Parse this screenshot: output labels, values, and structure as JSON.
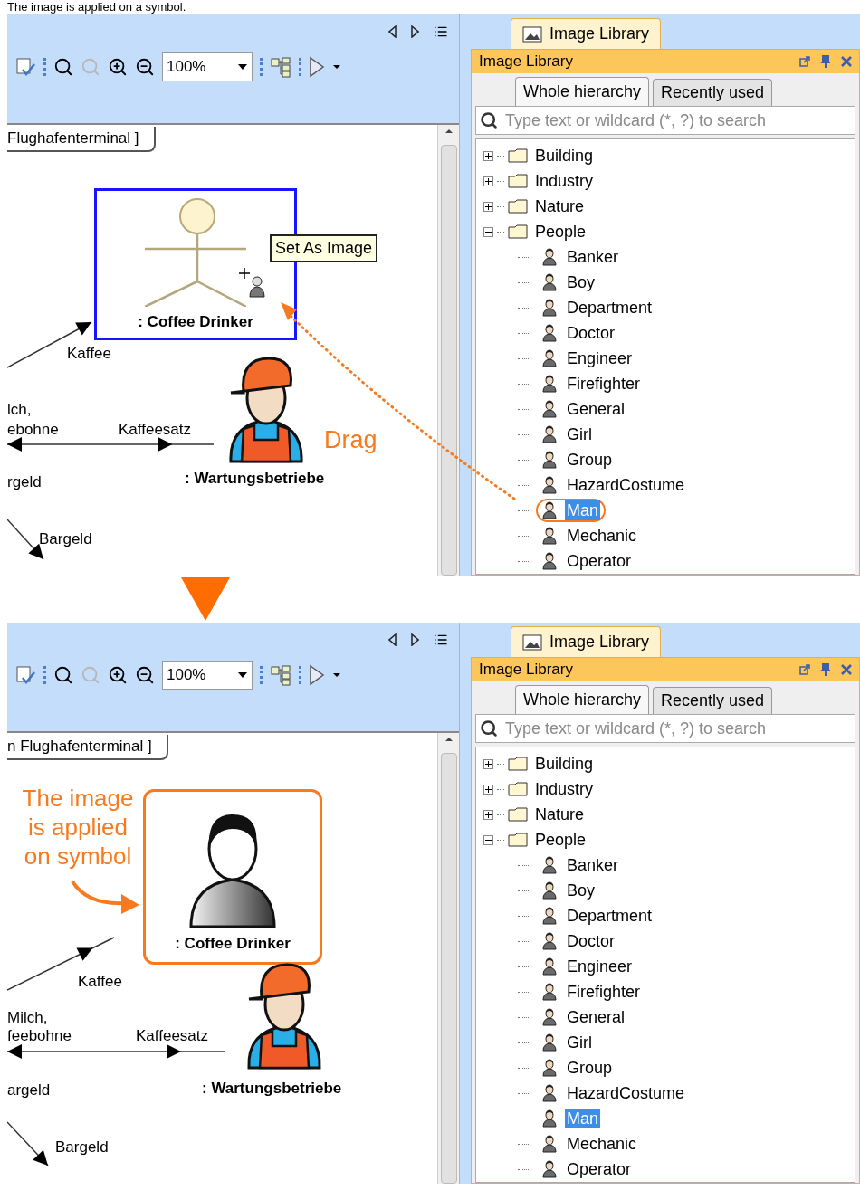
{
  "caption": "The image is applied on a symbol.",
  "steps": [
    {
      "kind": "drag",
      "editor": {
        "zoom": "100%",
        "frame_title": "Flughafenterminal ]",
        "actor": {
          "label": ": Coffee Drinker",
          "kind": "stick",
          "selected": true,
          "highlighted": false
        },
        "tooltip": "Set As Image",
        "annotation": "Drag",
        "worker_label": ": Wartungsbetriebe",
        "labels": [
          "Kaffee",
          "lch,",
          "ebohne",
          "Kaffeesatz",
          "rgeld",
          "Bargeld"
        ]
      },
      "library": {
        "tab": "Image Library",
        "title": "Image Library",
        "tabs": [
          {
            "label": "Whole hierarchy",
            "selected": true
          },
          {
            "label": "Recently used",
            "selected": false
          }
        ],
        "search": {
          "placeholder": "Type text or wildcard (*, ?) to search"
        },
        "tree": [
          {
            "label": "Building",
            "expanded": false
          },
          {
            "label": "Industry",
            "expanded": false
          },
          {
            "label": "Nature",
            "expanded": false
          },
          {
            "label": "People",
            "expanded": true,
            "children": [
              {
                "label": "Banker",
                "selected": false,
                "circled": false
              },
              {
                "label": "Boy",
                "selected": false,
                "circled": false
              },
              {
                "label": "Department",
                "selected": false,
                "circled": false
              },
              {
                "label": "Doctor",
                "selected": false,
                "circled": false
              },
              {
                "label": "Engineer",
                "selected": false,
                "circled": false
              },
              {
                "label": "Firefighter",
                "selected": false,
                "circled": false
              },
              {
                "label": "General",
                "selected": false,
                "circled": false
              },
              {
                "label": "Girl",
                "selected": false,
                "circled": false
              },
              {
                "label": "Group",
                "selected": false,
                "circled": false
              },
              {
                "label": "HazardCostume",
                "selected": false,
                "circled": false
              },
              {
                "label": "Man",
                "selected": true,
                "circled": true
              },
              {
                "label": "Mechanic",
                "selected": false,
                "circled": false
              },
              {
                "label": "Operator",
                "selected": false,
                "circled": false
              }
            ]
          }
        ]
      }
    },
    {
      "kind": "applied",
      "editor": {
        "zoom": "100%",
        "frame_title": "n Flughafenterminal ]",
        "actor": {
          "label": ": Coffee Drinker",
          "kind": "image",
          "selected": false,
          "highlighted": true
        },
        "annotation": "The image is applied on symbol",
        "worker_label": ": Wartungsbetriebe",
        "labels": [
          "Kaffee",
          "Milch,",
          "feebohne",
          "Kaffeesatz",
          "argeld",
          "Bargeld"
        ]
      },
      "library": {
        "tab": "Image Library",
        "title": "Image Library",
        "tabs": [
          {
            "label": "Whole hierarchy",
            "selected": true
          },
          {
            "label": "Recently used",
            "selected": false
          }
        ],
        "search": {
          "placeholder": "Type text or wildcard (*, ?) to search"
        },
        "tree": [
          {
            "label": "Building",
            "expanded": false
          },
          {
            "label": "Industry",
            "expanded": false
          },
          {
            "label": "Nature",
            "expanded": false
          },
          {
            "label": "People",
            "expanded": true,
            "children": [
              {
                "label": "Banker",
                "selected": false,
                "circled": false
              },
              {
                "label": "Boy",
                "selected": false,
                "circled": false
              },
              {
                "label": "Department",
                "selected": false,
                "circled": false
              },
              {
                "label": "Doctor",
                "selected": false,
                "circled": false
              },
              {
                "label": "Engineer",
                "selected": false,
                "circled": false
              },
              {
                "label": "Firefighter",
                "selected": false,
                "circled": false
              },
              {
                "label": "General",
                "selected": false,
                "circled": false
              },
              {
                "label": "Girl",
                "selected": false,
                "circled": false
              },
              {
                "label": "Group",
                "selected": false,
                "circled": false
              },
              {
                "label": "HazardCostume",
                "selected": false,
                "circled": false
              },
              {
                "label": "Man",
                "selected": true,
                "circled": false
              },
              {
                "label": "Mechanic",
                "selected": false,
                "circled": false
              },
              {
                "label": "Operator",
                "selected": false,
                "circled": false
              }
            ]
          }
        ]
      }
    }
  ]
}
